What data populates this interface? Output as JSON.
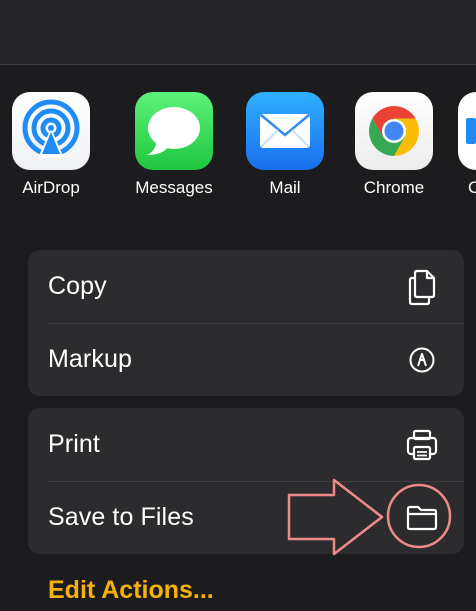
{
  "share_sheet": {
    "apps": [
      {
        "label": "AirDrop",
        "icon": "airdrop-icon"
      },
      {
        "label": "Messages",
        "icon": "messages-icon"
      },
      {
        "label": "Mail",
        "icon": "mail-icon"
      },
      {
        "label": "Chrome",
        "icon": "chrome-icon"
      },
      {
        "label": "C",
        "icon": "partial-app-icon"
      }
    ],
    "groups": [
      {
        "actions": [
          {
            "label": "Copy",
            "icon": "copy-icon"
          },
          {
            "label": "Markup",
            "icon": "markup-icon"
          }
        ]
      },
      {
        "actions": [
          {
            "label": "Print",
            "icon": "print-icon"
          },
          {
            "label": "Save to Files",
            "icon": "folder-icon"
          }
        ]
      }
    ],
    "edit_actions_label": "Edit Actions..."
  },
  "colors": {
    "background": "#1c1c1e",
    "group_background": "#2c2c2e",
    "accent": "#f5b10a",
    "annotation": "#f08a8a"
  }
}
